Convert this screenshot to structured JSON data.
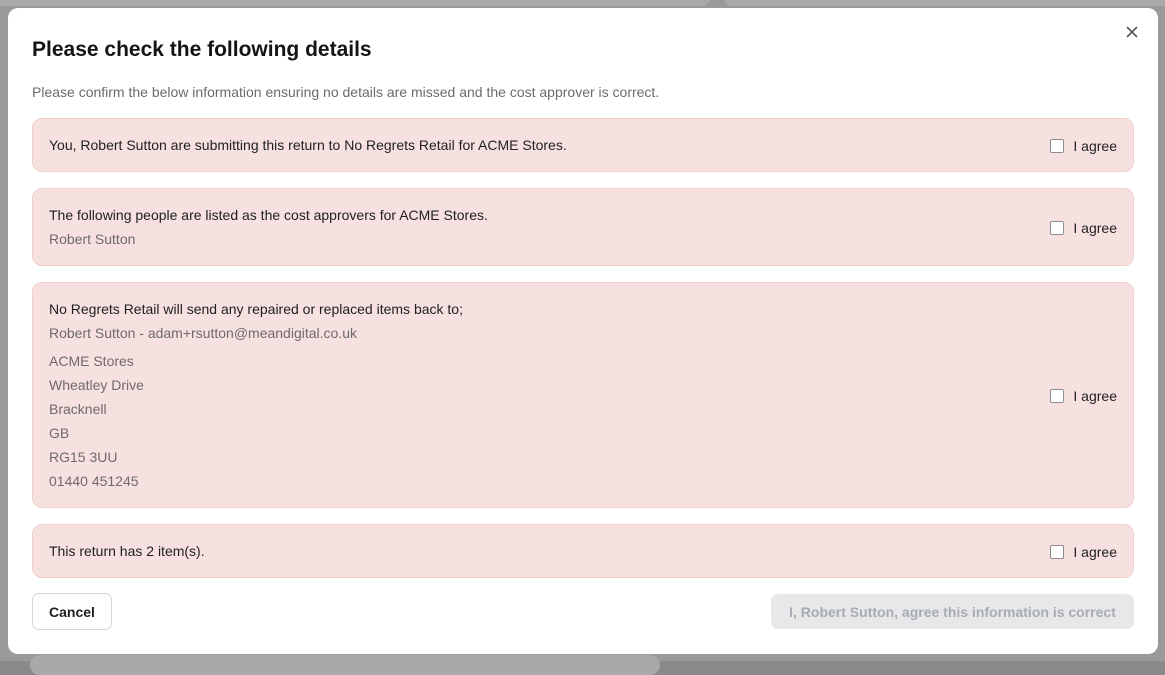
{
  "modal": {
    "title": "Please check the following details",
    "subtitle": "Please confirm the below information ensuring no details are missed and the cost approver is correct.",
    "close_icon": "close-icon"
  },
  "cards": {
    "submitter": {
      "text": "You, Robert Sutton are submitting this return to No Regrets Retail for ACME Stores.",
      "agree_label": "I agree",
      "checked": false
    },
    "approvers": {
      "text": "The following people are listed as the cost approvers for ACME Stores.",
      "names": "Robert Sutton",
      "agree_label": "I agree",
      "checked": false
    },
    "return_address": {
      "text": "No Regrets Retail will send any repaired or replaced items back to;",
      "contact": "Robert Sutton - adam+rsutton@meandigital.co.uk",
      "address_lines": [
        "ACME Stores",
        "Wheatley Drive",
        "Bracknell",
        "GB",
        "RG15 3UU",
        "01440 451245"
      ],
      "agree_label": "I agree",
      "checked": false
    },
    "items": {
      "text": "This return has 2 item(s).",
      "agree_label": "I agree",
      "checked": false
    }
  },
  "footer": {
    "cancel_label": "Cancel",
    "confirm_label": "I, Robert Sutton, agree this information is correct",
    "confirm_disabled": true
  },
  "colors": {
    "card_bg": "#f7e1e0",
    "card_border": "#f0cfcc",
    "confirm_disabled_bg": "#e7e8ea"
  }
}
